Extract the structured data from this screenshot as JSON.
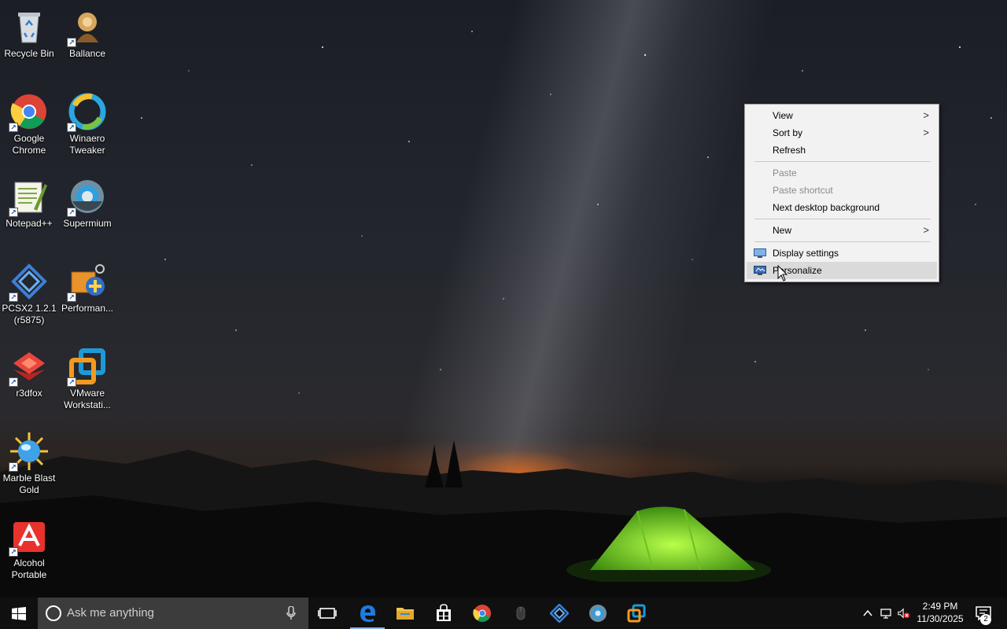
{
  "desktop": {
    "icons": [
      {
        "label": "Recycle Bin",
        "icon": "recycle-bin-icon"
      },
      {
        "label": "Ballance",
        "icon": "ballance-icon"
      },
      {
        "label": "Google Chrome",
        "icon": "chrome-icon"
      },
      {
        "label": "Winaero Tweaker",
        "icon": "winaero-tweaker-icon"
      },
      {
        "label": "Notepad++",
        "icon": "notepad-plus-plus-icon"
      },
      {
        "label": "Supermium",
        "icon": "supermium-icon"
      },
      {
        "label": "PCSX2 1.2.1 (r5875)",
        "icon": "pcsx2-icon"
      },
      {
        "label": "Performan...",
        "icon": "performance-icon"
      },
      {
        "label": "r3dfox",
        "icon": "r3dfox-icon"
      },
      {
        "label": "VMware Workstati...",
        "icon": "vmware-icon"
      },
      {
        "label": "Marble Blast Gold",
        "icon": "marble-blast-icon"
      },
      {
        "label": "Alcohol Portable",
        "icon": "alcohol-icon"
      }
    ]
  },
  "context_menu": {
    "items": [
      {
        "label": "View",
        "submenu": true,
        "enabled": true
      },
      {
        "label": "Sort by",
        "submenu": true,
        "enabled": true
      },
      {
        "label": "Refresh",
        "enabled": true
      },
      {
        "label": "Paste",
        "enabled": false
      },
      {
        "label": "Paste shortcut",
        "enabled": false
      },
      {
        "label": "Next desktop background",
        "enabled": true
      },
      {
        "label": "New",
        "submenu": true,
        "enabled": true
      },
      {
        "label": "Display settings",
        "icon": "display-icon",
        "enabled": true
      },
      {
        "label": "Personalize",
        "icon": "personalize-icon",
        "enabled": true,
        "highlighted": true
      }
    ]
  },
  "taskbar": {
    "search_placeholder": "Ask me anything",
    "pinned": [
      "task-view-icon",
      "edge-icon",
      "file-explorer-icon",
      "store-icon",
      "chrome-icon",
      "mouse-icon",
      "pcsx2-icon",
      "supermium-icon",
      "vmware-icon"
    ],
    "clock": {
      "time": "2:49 PM",
      "date": "11/30/2025"
    },
    "notification_count": "2"
  },
  "colors": {
    "taskbar": "#101010",
    "search_box": "#3c3c3c",
    "menu_bg": "#f2f2f2",
    "menu_highlight": "#dadada",
    "edge_blue": "#1e7ae0"
  }
}
